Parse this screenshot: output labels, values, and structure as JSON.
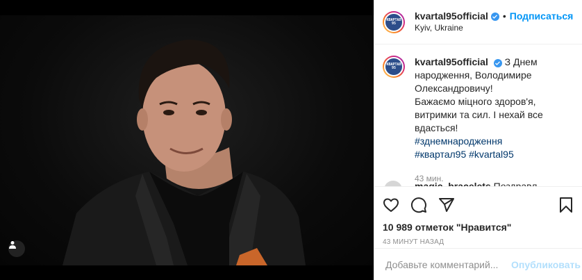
{
  "post": {
    "author": "kvartal95official",
    "follow_label": "Подписаться",
    "separator": "•",
    "location": "Kyiv, Ukraine",
    "avatar_text": "КВАРТАЛ 95",
    "photo_alt": "Portrait photo",
    "caption": {
      "text_lines": [
        "З Днем",
        "народження, Володимире",
        "Олександровичу!",
        "Бажаємо міцного здоров'я,",
        "витримки та сил. І нехай все",
        "вдасться!"
      ],
      "hashtags": [
        "#зднемнародження",
        "#квартал95",
        "#kvartal95"
      ],
      "time": "43 мин."
    },
    "next_comment": {
      "author": "magic_bracelets",
      "text": "Поздравл"
    },
    "likes": "10 989 отметок \"Нравится\"",
    "posted_ago": "43 минут назад",
    "comment_placeholder": "Добавьте комментарий...",
    "publish_label": "Опубликовать"
  },
  "icons": {
    "like": "heart-icon",
    "comment": "comment-icon",
    "share": "paper-plane-icon",
    "save": "bookmark-icon",
    "verified": "verified-badge-icon",
    "tag": "user-tag-icon"
  },
  "colors": {
    "link": "#0095f6",
    "hashtag": "#00376b",
    "verified": "#3897f0",
    "muted": "#8e8e8e",
    "publish_disabled": "#b2dffc"
  }
}
